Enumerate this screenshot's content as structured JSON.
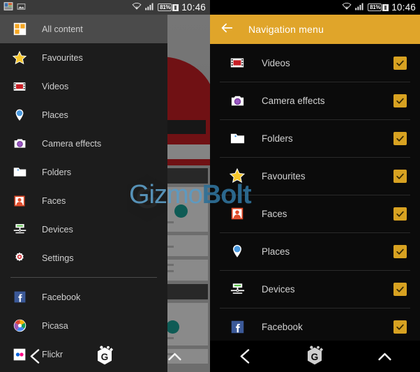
{
  "theme": {
    "amber": "#e0a52a",
    "checkbox": "#d8a221",
    "drawer_bg": "#1c1c1c",
    "selected_row_bg": "#4b4b4b",
    "list_bg": "#0b0b0b",
    "text": "#cfcfcf"
  },
  "status_bar": {
    "wifi_icon": "wifi-icon",
    "signal_icon": "signal-icon",
    "battery_label": "81%",
    "battery_charging_icon": "battery-charging-icon",
    "clock": "10:46",
    "notif_gallery_icon": "gallery-notification-icon",
    "notif_image_icon": "image-notification-icon"
  },
  "left_screen": {
    "drawer": {
      "items": [
        {
          "label": "All content",
          "icon": "all-content-icon",
          "selected": true
        },
        {
          "label": "Favourites",
          "icon": "star-icon",
          "selected": false
        },
        {
          "label": "Videos",
          "icon": "film-strip-icon",
          "selected": false
        },
        {
          "label": "Places",
          "icon": "map-pin-icon",
          "selected": false
        },
        {
          "label": "Camera effects",
          "icon": "camera-icon",
          "selected": false
        },
        {
          "label": "Folders",
          "icon": "folder-icon",
          "selected": false
        },
        {
          "label": "Faces",
          "icon": "face-portrait-icon",
          "selected": false
        },
        {
          "label": "Devices",
          "icon": "devices-icon",
          "selected": false
        },
        {
          "label": "Settings",
          "icon": "gear-icon",
          "selected": false
        }
      ],
      "services": [
        {
          "label": "Facebook",
          "icon": "facebook-icon"
        },
        {
          "label": "Picasa",
          "icon": "picasa-icon"
        },
        {
          "label": "Flickr",
          "icon": "flickr-icon"
        }
      ]
    }
  },
  "right_screen": {
    "appbar": {
      "back_icon": "back-arrow-icon",
      "title": "Navigation menu"
    },
    "items": [
      {
        "label": "Videos",
        "icon": "film-strip-icon",
        "checked": true
      },
      {
        "label": "Camera effects",
        "icon": "camera-icon",
        "checked": true
      },
      {
        "label": "Folders",
        "icon": "folder-icon",
        "checked": true
      },
      {
        "label": "Favourites",
        "icon": "star-icon",
        "checked": true
      },
      {
        "label": "Faces",
        "icon": "face-portrait-icon",
        "checked": true
      },
      {
        "label": "Places",
        "icon": "map-pin-icon",
        "checked": true
      },
      {
        "label": "Devices",
        "icon": "devices-icon",
        "checked": true
      },
      {
        "label": "Facebook",
        "icon": "facebook-icon",
        "checked": true
      }
    ]
  },
  "navbar": {
    "back_icon": "system-back-icon",
    "home_icon": "gizmobolt-home-icon",
    "recents_icon": "system-recents-icon"
  },
  "watermark": {
    "text_light": "Gizmo",
    "text_bold": "Bolt"
  }
}
